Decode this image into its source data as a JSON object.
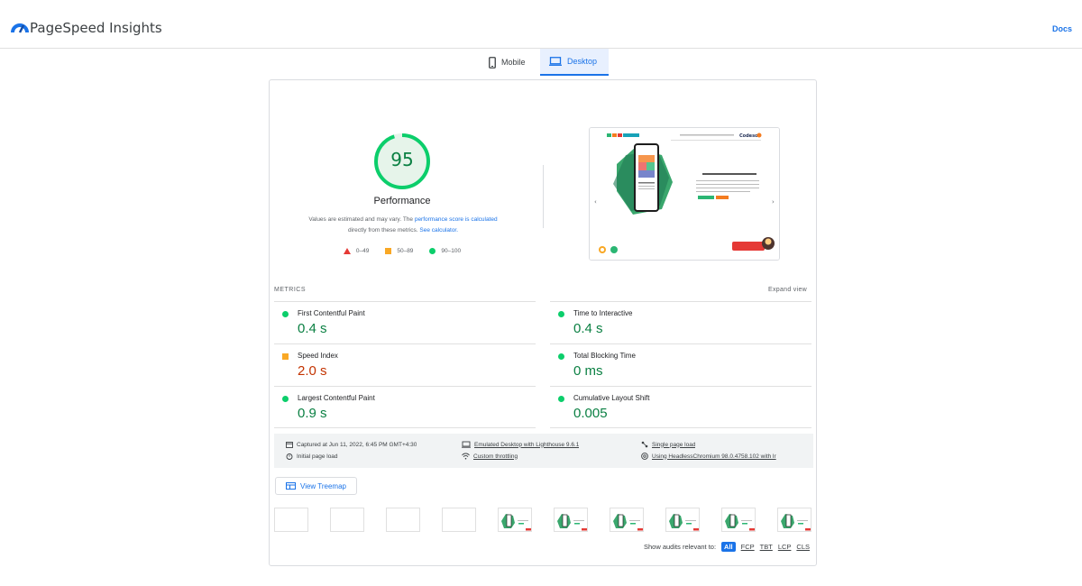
{
  "header": {
    "brand": "PageSpeed Insights",
    "docs_label": "Docs",
    "logo_icon": "pagespeed-logo-icon"
  },
  "tabs": [
    {
      "label": "Mobile",
      "icon": "phone-icon",
      "selected": false
    },
    {
      "label": "Desktop",
      "icon": "laptop-icon",
      "selected": true
    }
  ],
  "performance": {
    "score": "95",
    "score_fraction": 0.95,
    "title": "Performance",
    "note_prefix": "Values are estimated and may vary. The ",
    "note_link1": "performance score is calculated",
    "note_middle": "directly from these metrics. ",
    "note_link2": "See calculator.",
    "legend": [
      {
        "label": "0–49",
        "shape": "triangle",
        "color": "#e53935"
      },
      {
        "label": "50–89",
        "shape": "square",
        "color": "#f9a825"
      },
      {
        "label": "90–100",
        "shape": "circle",
        "color": "#0cce6b"
      }
    ]
  },
  "metrics": {
    "heading": "METRICS",
    "expand_label": "Expand view",
    "items": [
      {
        "name": "First Contentful Paint",
        "value": "0.4 s",
        "status": "good"
      },
      {
        "name": "Time to Interactive",
        "value": "0.4 s",
        "status": "good"
      },
      {
        "name": "Speed Index",
        "value": "2.0 s",
        "status": "average"
      },
      {
        "name": "Total Blocking Time",
        "value": "0 ms",
        "status": "good"
      },
      {
        "name": "Largest Contentful Paint",
        "value": "0.9 s",
        "status": "good"
      },
      {
        "name": "Cumulative Layout Shift",
        "value": "0.005",
        "status": "good"
      }
    ]
  },
  "runtime": {
    "captured": "Captured at Jun 11, 2022, 6:45 PM GMT+4:30",
    "initial_load": "Initial page load",
    "emulated": "Emulated Desktop with Lighthouse 9.6.1",
    "throttling": "Custom throttling",
    "single_load": "Single page load",
    "browser": "Using HeadlessChromium 98.0.4758.102 with lr"
  },
  "treemap_label": "View Treemap",
  "audits": {
    "label": "Show audits relevant to:",
    "filters": [
      "All",
      "FCP",
      "TBT",
      "LCP",
      "CLS"
    ]
  },
  "colors": {
    "accent": "#1a73e8",
    "good": "#0cce6b",
    "good_text": "#0b8043",
    "average": "#f9a825",
    "average_text": "#c33300",
    "poor": "#e53935"
  }
}
